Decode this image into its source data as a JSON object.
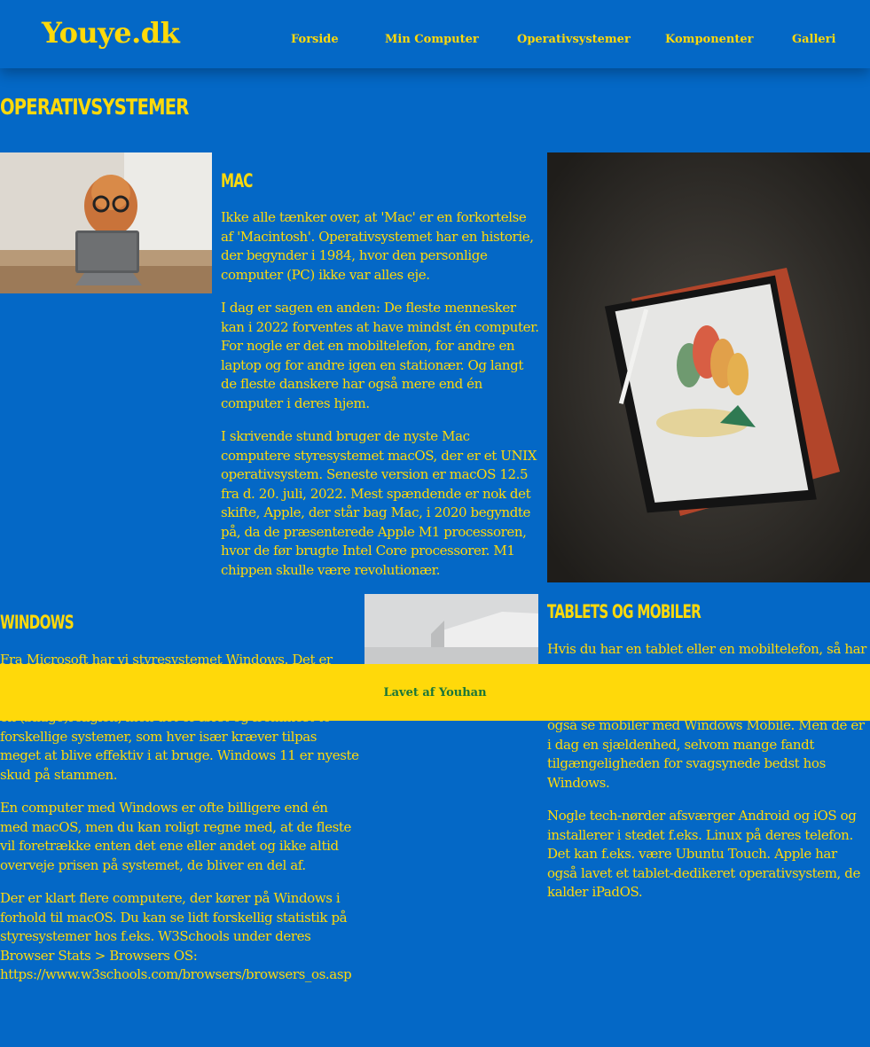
{
  "header": {
    "logo": "Youye.dk",
    "nav": [
      "Forside",
      "Min Computer",
      "Operativsystemer",
      "Komponenter",
      "Galleri"
    ]
  },
  "page": {
    "title": "Operativsystemer"
  },
  "mac": {
    "heading": "Mac",
    "paragraphs": [
      "Ikke alle tænker over, at 'Mac' er en forkortelse af 'Macintosh'. Operativsystemet har en historie, der begynder i 1984, hvor den personlige computer (PC) ikke var alles eje.",
      "I dag er sagen en anden: De fleste mennesker kan i 2022 forventes at have mindst én computer. For nogle er det en mobiltelefon, for andre en laptop og for andre igen en stationær. Og langt de fleste danskere har også mere end én computer i deres hjem.",
      "I skrivende stund bruger de nyste Mac computere styresystemet macOS, der er et UNIX operativsystem. Seneste version er macOS 12.5 fra d. 20. juli, 2022. Mest spændende er nok det skifte, Apple, der står bag Mac, i 2020 begyndte på, da de præsenterede Apple M1 processoren, hvor de før brugte Intel Core processorer. M1 chippen skulle være revolutionær."
    ]
  },
  "windows": {
    "heading": "Windows",
    "paragraphs": [
      "Fra Microsoft har vi styresystemet Windows. Det er",
      "en (bliage)religion, men det er først og fremmest to forskellige systemer, som hver især kræver tilpas meget at blive effektiv i at bruge. Windows 11 er nyeste skud på stammen.",
      "En computer med Windows er ofte billigere end én med macOS, men du kan roligt regne med, at de fleste vil foretrække enten det ene eller andet og ikke altid overveje prisen på systemet, de bliver en del af.",
      "Der er klart flere computere, der kører på Windows i forhold til macOS. Du kan se lidt forskellig statistik på styresystemer hos f.eks. W3Schools under deres Browser Stats > Browsers OS: https://www.w3schools.com/browsers/browsers_os.asp"
    ]
  },
  "tablets": {
    "heading": "Tablets og mobiler",
    "paragraphs": [
      "Hvis du har en tablet eller en mobiltelefon, så har",
      "også se mobiler med Windows Mobile. Men de er i dag en sjældenhed, selvom mange fandt tilgængeligheden for svagsynede bedst hos Windows.",
      "Nogle tech-nørder afsværger Android og iOS og installerer i stedet f.eks. Linux på deres telefon. Det kan f.eks. være Ubuntu Touch. Apple har også lavet et tablet-dedikeret operativsystem, de kalder iPadOS."
    ]
  },
  "footer": {
    "text": "Lavet af Youhan"
  },
  "colors": {
    "background": "#0468c6",
    "accent": "#ffd90a",
    "footer_text": "#19753a"
  }
}
